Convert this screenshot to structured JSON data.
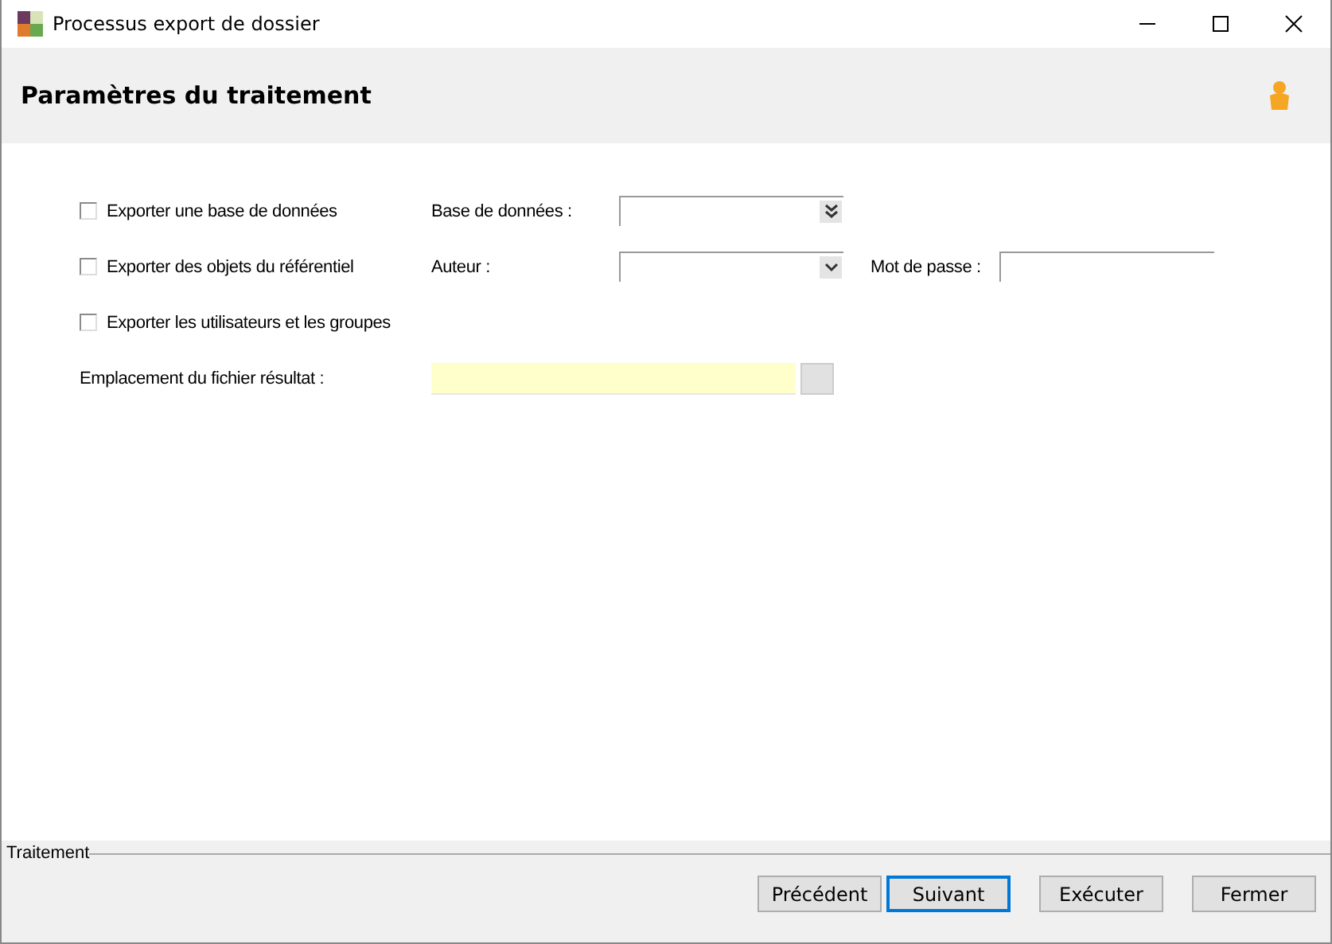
{
  "window": {
    "title": "Processus export de dossier"
  },
  "header": {
    "title": "Paramètres du traitement"
  },
  "options": [
    {
      "label": "Exporter une base de données",
      "checked": false
    },
    {
      "label": "Exporter des objets du référentiel",
      "checked": false
    },
    {
      "label": "Exporter les utilisateurs et les groupes",
      "checked": false
    }
  ],
  "database_label": "Base de données :",
  "author_label": "Auteur :",
  "password_label": "Mot de passe :",
  "output_label": "Emplacement du fichier résultat :",
  "progress_group": {
    "title": "Traitement"
  },
  "buttons": [
    {
      "label": "Précédent",
      "focused": false
    },
    {
      "label": "Suivant",
      "focused": true
    },
    {
      "label": "Exécuter",
      "focused": false
    },
    {
      "label": "Fermer",
      "focused": false
    }
  ]
}
